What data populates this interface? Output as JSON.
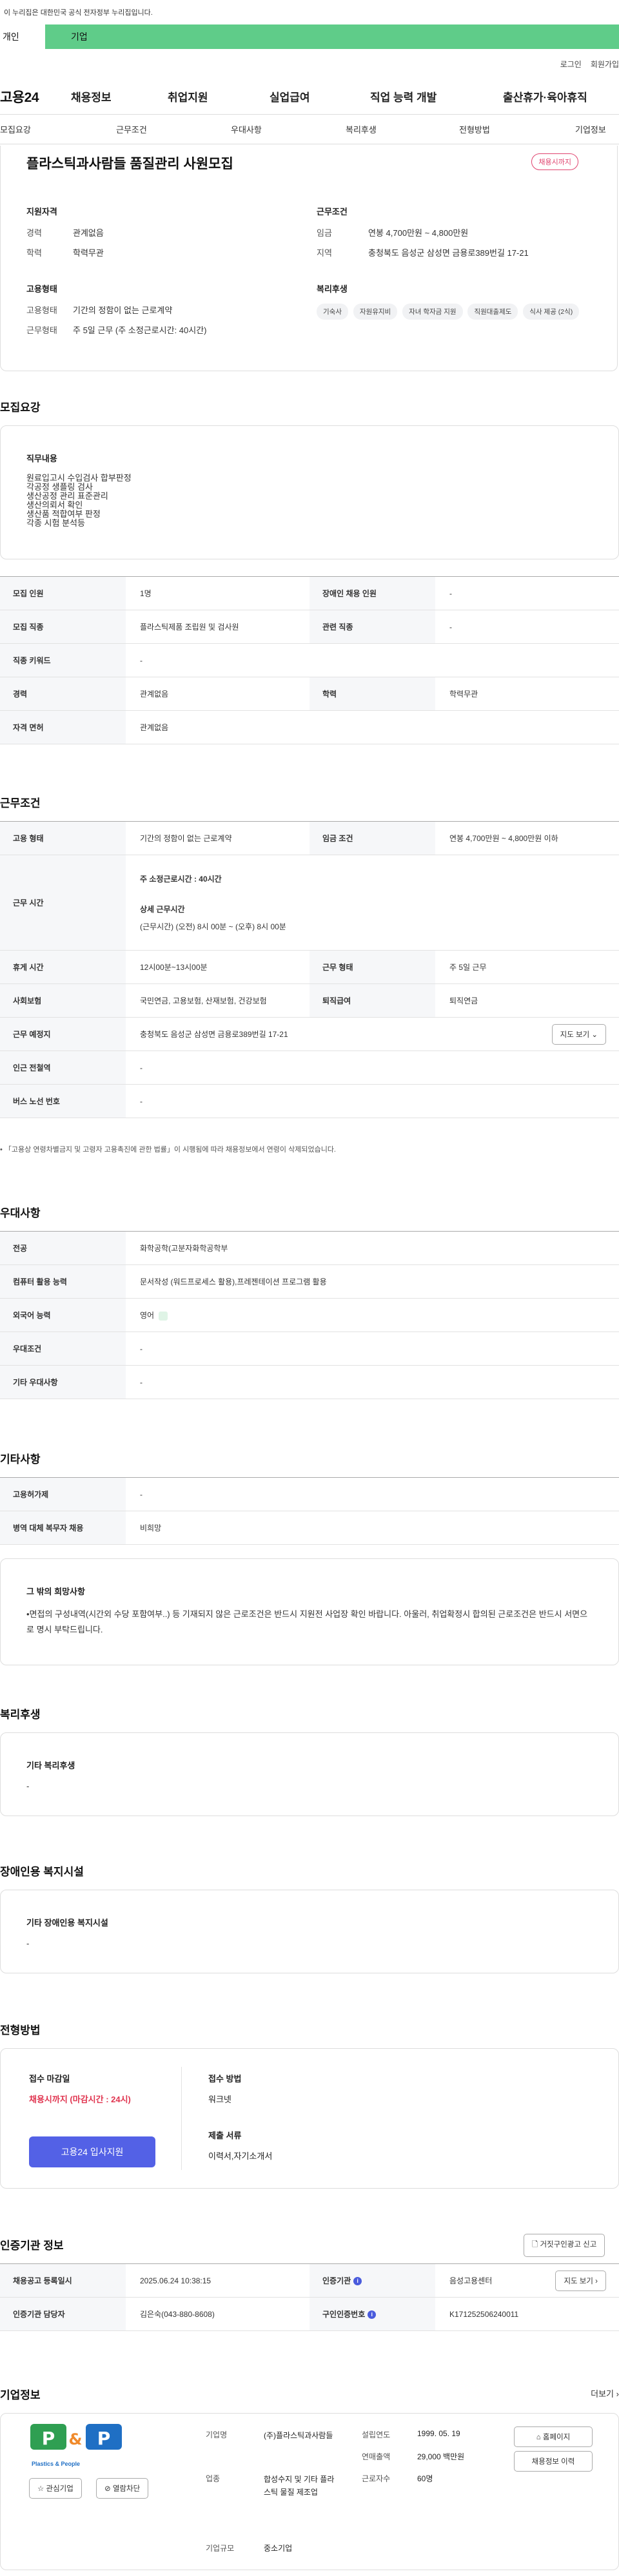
{
  "gov_banner": "이 누리집은 대한민국 공식 전자정부 누리집입니다.",
  "user_tabs": {
    "person": "개인",
    "corp": "기업"
  },
  "util": {
    "login": "로그인",
    "join": "회원가입"
  },
  "logo": "고용24",
  "gnb": [
    "채용정보",
    "취업지원",
    "실업급여",
    "직업 능력 개발",
    "출산휴가·육아휴직"
  ],
  "subnav": [
    "모집요강",
    "근무조건",
    "우대사항",
    "복리후생",
    "전형방법",
    "기업정보"
  ],
  "summary": {
    "title": "플라스틱과사람들 품질관리 사원모집",
    "badge": "채용시까지",
    "qual": {
      "heading": "지원자격",
      "rows": [
        {
          "k": "경력",
          "v": "관계없음"
        },
        {
          "k": "학력",
          "v": "학력무관"
        }
      ]
    },
    "cond": {
      "heading": "근무조건",
      "rows": [
        {
          "k": "임금",
          "v": "연봉 4,700만원 ~ 4,800만원"
        },
        {
          "k": "지역",
          "v": "충청북도 음성군 삼성면 금용로389번길 17-21"
        }
      ]
    },
    "type": {
      "heading": "고용형태",
      "rows": [
        {
          "k": "고용형태",
          "v": "기간의 정함이 없는 근로계약"
        },
        {
          "k": "근무형태",
          "v": "주 5일 근무 (주 소정근로시간: 40시간)"
        }
      ]
    },
    "welfare": {
      "heading": "복리후생",
      "chips": [
        "기숙사",
        "자원유지비",
        "자녀 학자금 지원",
        "직원대출제도",
        "식사 제공 (2식)"
      ]
    }
  },
  "recruit": {
    "title": "모집요강",
    "duty_heading": "직무내용",
    "duties": [
      "원료입고시 수입검사 합부판정",
      "각공정 생플링 검사",
      "생산공정 관리 표준관리",
      "생산의뢰서 확인",
      "생산품 적합여부 판정",
      "각종 시험 분석등"
    ],
    "rows": [
      [
        "모집 인원",
        "1명",
        "장애인 채용 인원",
        "-"
      ],
      [
        "모집 직종",
        "플라스틱제품 조립원 및 검사원",
        "관련 직종",
        "-"
      ],
      [
        "직종 키워드",
        "-"
      ],
      [
        "경력",
        "관계없음",
        "학력",
        "학력무관"
      ],
      [
        "자격 면허",
        "관계없음"
      ]
    ]
  },
  "work": {
    "title": "근무조건",
    "employ_type_label": "고용 형태",
    "employ_type": "기간의 정함이 없는 근로계약",
    "wage_label": "임금 조건",
    "wage": "연봉 4,700만원 ~ 4,800만원 이하",
    "hours_label": "근무 시간",
    "hours_main": "주 소정근로시간 : 40시간",
    "hours_detail_title": "상세 근무시간",
    "hours_detail": "(근무시간) (오전) 8시 00분 ~ (오후) 8시 00분",
    "rest_label": "휴게 시간",
    "rest": "12시00분~13시00분",
    "shift_label": "근무 형태",
    "shift": "주 5일 근무",
    "insurance_label": "사회보험",
    "insurance": "국민연금, 고용보험, 산재보험, 건강보험",
    "retire_label": "퇴직급여",
    "retire": "퇴직연금",
    "place_label": "근무 예정지",
    "place": "충청북도 음성군 삼성면 금용로389번길 17-21",
    "map_btn": "지도 보기",
    "subway_label": "인근 전철역",
    "subway": "-",
    "bus_label": "버스 노선 번호",
    "bus": "-",
    "note": "「고용상 연령차별금지 및 고령자 고용촉진에 관한 법률」이 시행됨에 따라 채용정보에서 연령이 삭제되었습니다."
  },
  "pref": {
    "title": "우대사항",
    "rows": [
      [
        "전공",
        "화학공학(고분자화학공학부"
      ],
      [
        "컴퓨터 활용 능력",
        "문서작성 (워드프로세스 활용),프레젠테이션 프로그램 활용"
      ],
      [
        "외국어 능력",
        "영어"
      ],
      [
        "우대조건",
        "-"
      ],
      [
        "기타 우대사항",
        "-"
      ]
    ],
    "lang_chip_icon": "green-badge-icon"
  },
  "etc": {
    "title": "기타사항",
    "rows": [
      [
        "고용허가제",
        "-"
      ],
      [
        "병역 대체 복무자 채용",
        "비희망"
      ]
    ],
    "extra_heading": "그 밖의 희망사항",
    "extra_text": "•면접의 구성내역(시간외 수당 포함여부..) 등 기재되지 않은 근로조건은 반드시 지원전 사업장 확인 바랍니다. 아울러, 취업확정시 합의된 근로조건은 반드시 서면으로 명시 부탁드립니다."
  },
  "welfare": {
    "title": "복리후생",
    "heading": "기타 복리후생",
    "value": "-"
  },
  "disab": {
    "title": "장애인용 복지시설",
    "heading": "기타 장애인용 복지시설",
    "value": "-"
  },
  "selection": {
    "title": "전형방법",
    "deadline_label": "접수 마감일",
    "deadline": "채용시까지 (마감시간 : 24시)",
    "apply_btn": "고용24 입사지원",
    "method_label": "접수 방법",
    "method": "워크넷",
    "docs_label": "제출 서류",
    "docs": "이력서,자기소개서"
  },
  "cert": {
    "title": "인증기관 정보",
    "report_btn": "거짓구인광고 신고",
    "reg_label": "채용공고 등록일시",
    "reg": "2025.06.24 10:38:15",
    "agency_label": "인증기관",
    "agency": "음성고용센터",
    "map_btn": "지도 보기",
    "manager_label": "인증기관 담당자",
    "manager": "김은숙(043-880-8608)",
    "num_label": "구인인증번호",
    "num": "K171252506240011"
  },
  "company": {
    "title": "기업정보",
    "more": "더보기",
    "logo_text": "Plastics & People",
    "fav_btn": "관심기업",
    "block_btn": "열람차단",
    "name_label": "기업명",
    "name": "(주)플라스틱과사람들",
    "industry_label": "업종",
    "industry": "합성수지 및 기타 플라스틱 물질 제조업",
    "size_label": "기업규모",
    "size": "중소기업",
    "founded_label": "설립연도",
    "founded": "1999. 05. 19",
    "sales_label": "연매출액",
    "sales": "29,000 백만원",
    "employees_label": "근로자수",
    "employees": "60명",
    "home_btn": "홈페이지",
    "jobs_btn": "채용정보 이력"
  }
}
